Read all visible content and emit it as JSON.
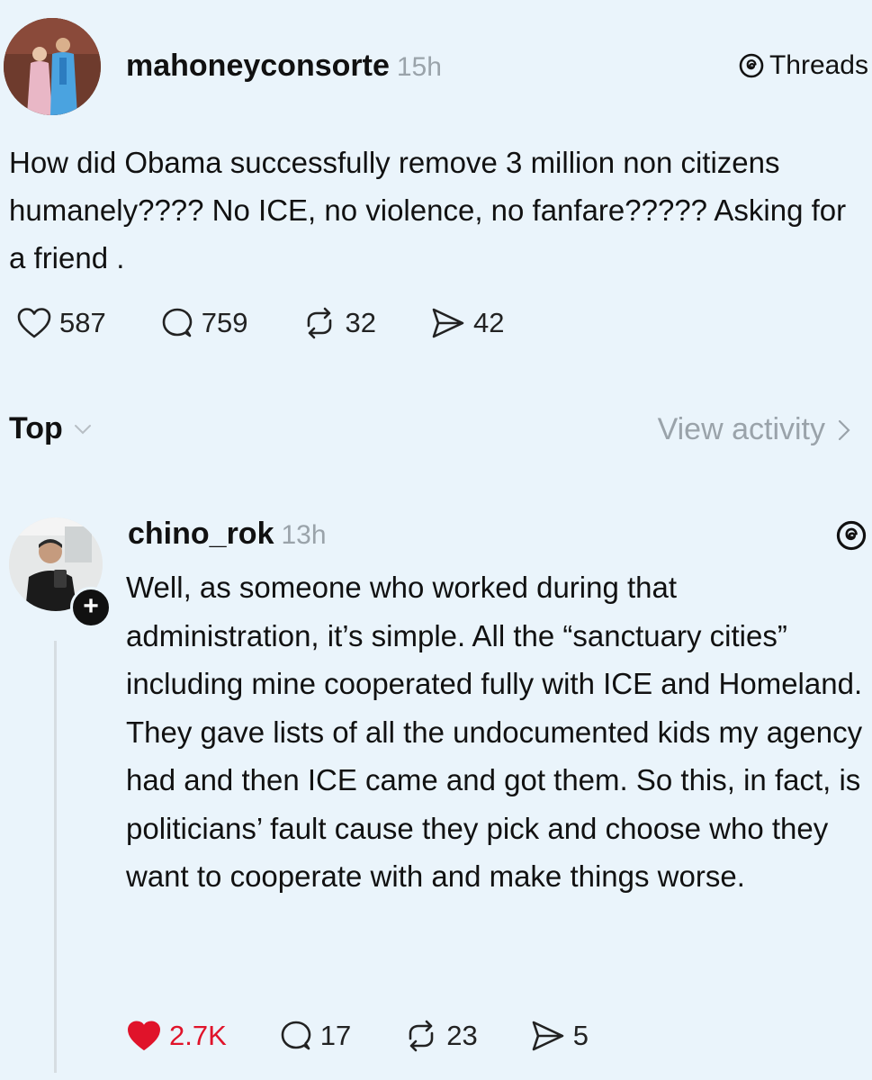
{
  "post": {
    "username": "mahoneyconsorte",
    "time": "15h",
    "source_label": "Threads",
    "text": "How did Obama successfully remove 3 million non citizens humanely???? No ICE, no violence, no fanfare????? Asking for a friend .",
    "actions": {
      "likes": "587",
      "replies": "759",
      "reposts": "32",
      "shares": "42"
    }
  },
  "sort": {
    "label": "Top",
    "view_activity": "View activity"
  },
  "reply": {
    "username": "chino_rok",
    "time": "13h",
    "text": "Well, as someone who worked during that administration, it’s simple. All the “sanctuary cities” including mine cooperated fully with ICE and Homeland. They gave lists of all the undocumented kids my agency had and then ICE came and got them. So this, in fact, is politicians’ fault cause they pick and choose who they want to cooperate with and make things worse.",
    "actions": {
      "likes": "2.7K",
      "replies": "17",
      "reposts": "23",
      "shares": "5"
    },
    "liked": true
  },
  "colors": {
    "background": "#eaf4fb",
    "muted_text": "#9aa3aa",
    "like_red": "#e0132a"
  }
}
